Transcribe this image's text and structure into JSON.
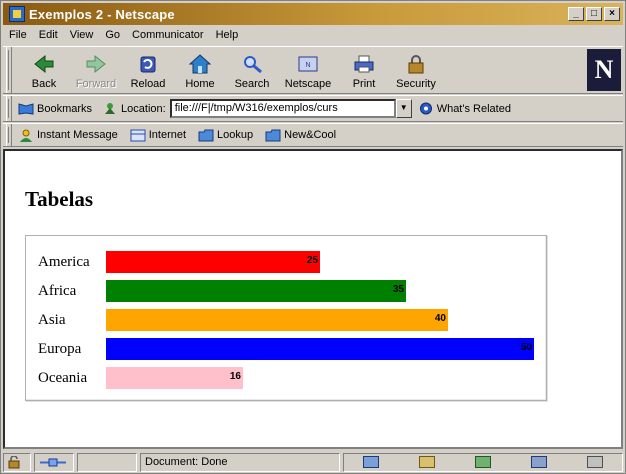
{
  "window": {
    "title": "Exemplos 2 - Netscape",
    "btn_min": "_",
    "btn_max": "□",
    "btn_close": "×"
  },
  "menu": [
    "File",
    "Edit",
    "View",
    "Go",
    "Communicator",
    "Help"
  ],
  "nav_buttons": [
    {
      "label": "Back",
      "icon": "back-arrow-icon",
      "color": "#2a8a3a",
      "enabled": true
    },
    {
      "label": "Forward",
      "icon": "forward-arrow-icon",
      "color": "#7fbf8a",
      "enabled": false
    },
    {
      "label": "Reload",
      "icon": "reload-icon",
      "color": "#3a5ab8",
      "enabled": true
    },
    {
      "label": "Home",
      "icon": "home-icon",
      "color": "#2e7ec8",
      "enabled": true
    },
    {
      "label": "Search",
      "icon": "search-icon",
      "color": "#2f5ac6",
      "enabled": true
    },
    {
      "label": "Netscape",
      "icon": "netscape-icon",
      "color": "#6a7ab8",
      "enabled": true
    },
    {
      "label": "Print",
      "icon": "print-icon",
      "color": "#4a6ac8",
      "enabled": true
    },
    {
      "label": "Security",
      "icon": "security-lock-icon",
      "color": "#b8862a",
      "enabled": true
    }
  ],
  "location_bar": {
    "bookmarks_label": "Bookmarks",
    "location_label": "Location:",
    "url": "file:///F|/tmp/W316/exemplos/curs",
    "related_label": "What's Related"
  },
  "personal_toolbar": [
    {
      "label": "Instant Message",
      "icon": "instant-message-icon"
    },
    {
      "label": "Internet",
      "icon": "internet-icon"
    },
    {
      "label": "Lookup",
      "icon": "folder-icon"
    },
    {
      "label": "New&Cool",
      "icon": "folder-icon"
    }
  ],
  "page": {
    "title": "Tabelas",
    "rows": [
      {
        "label": "America",
        "value": 25,
        "color": "#ff0000"
      },
      {
        "label": "Africa",
        "value": 35,
        "color": "#008000"
      },
      {
        "label": "Asia",
        "value": 40,
        "color": "#ffa500"
      },
      {
        "label": "Europa",
        "value": 50,
        "color": "#0000ff"
      },
      {
        "label": "Oceania",
        "value": 16,
        "color": "#ffc0cb"
      }
    ]
  },
  "status": {
    "text": "Document: Done"
  }
}
